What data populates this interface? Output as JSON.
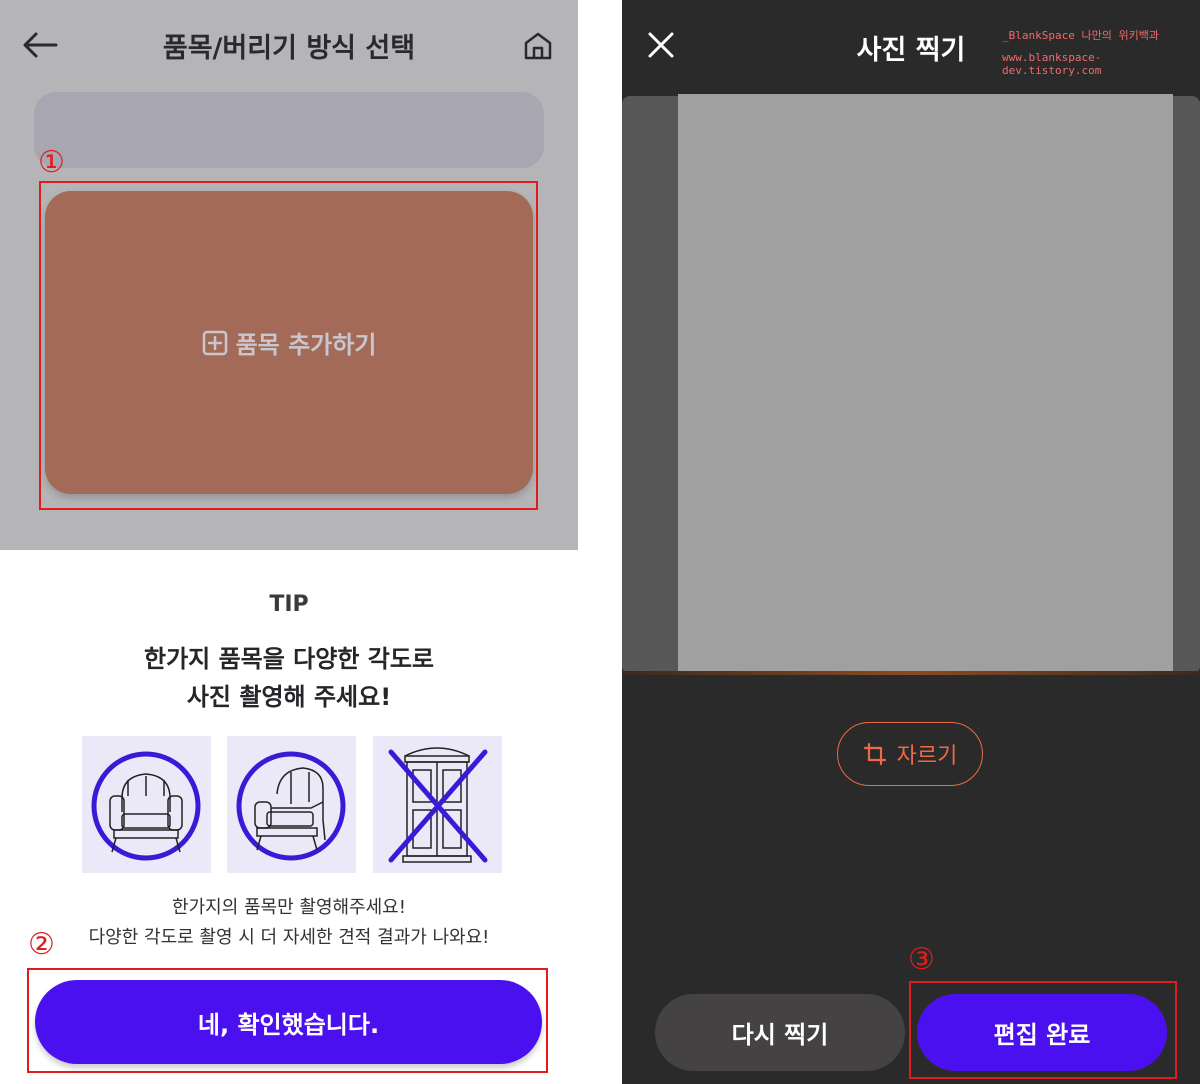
{
  "left_screen": {
    "header": {
      "title": "품목/버리기 방식 선택",
      "back_icon": "arrow-left-icon",
      "home_icon": "home-icon"
    },
    "annotations": [
      "①",
      "②"
    ],
    "add_item": {
      "label": "품목 추가하기",
      "icon": "plus-square-icon"
    },
    "tip_sheet": {
      "tip_label": "TIP",
      "headline_line1": "한가지 품목을 다양한 각도로",
      "headline_line2": "사진 촬영해 주세요!",
      "examples": [
        {
          "icon": "armchair-front-icon",
          "status": "correct"
        },
        {
          "icon": "armchair-angle-icon",
          "status": "correct"
        },
        {
          "icon": "wardrobe-crossed-icon",
          "status": "incorrect"
        }
      ],
      "desc_line1": "한가지의 품목만 촬영해주세요!",
      "desc_line2": "다양한 각도로 촬영 시 더 자세한 견적 결과가 나와요!",
      "confirm_label": "네, 확인했습니다."
    }
  },
  "right_screen": {
    "header": {
      "title": "사진 찍기",
      "close_icon": "close-icon"
    },
    "watermark": {
      "line1": "_BlankSpace 나만의 위키백과",
      "line2": "www.blankspace-dev.tistory.com"
    },
    "annotation": "③",
    "crop_label": "자르기",
    "crop_icon": "crop-icon",
    "retake_label": "다시 찍기",
    "done_label": "편집 완료"
  },
  "colors": {
    "primary": "#4b10f0",
    "annotation_red": "#e01c1c",
    "card_brown": "#a36b57",
    "crop_orange": "#ea6b45",
    "dark_bg": "#2b2a2a"
  }
}
